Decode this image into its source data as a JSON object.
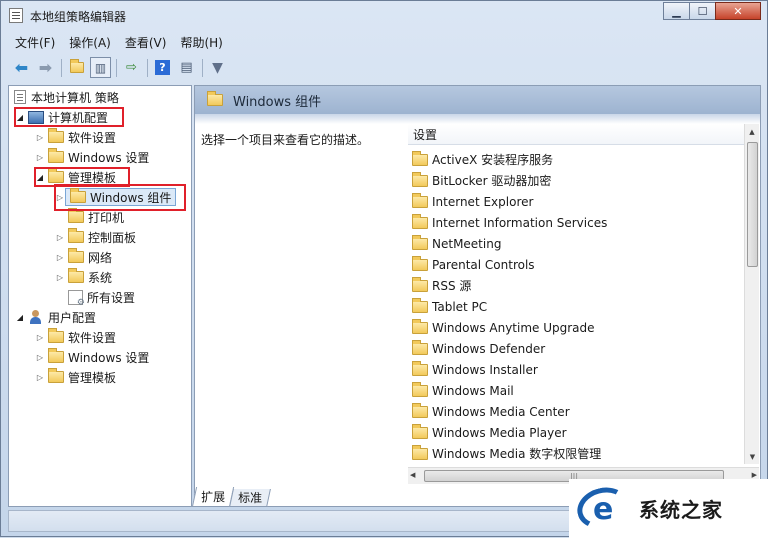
{
  "window": {
    "title": "本地组策略编辑器",
    "controls": {
      "minimize": "▁",
      "maximize": "☐",
      "close": "✕"
    }
  },
  "menu": [
    "文件(F)",
    "操作(A)",
    "查看(V)",
    "帮助(H)"
  ],
  "toolbar": {
    "buttons": [
      "back-icon",
      "forward-icon",
      "up-folder-icon",
      "show-hide-tree-icon",
      "export-list-icon",
      "help-icon",
      "properties-icon",
      "filter-icon"
    ]
  },
  "tree": {
    "root": "本地计算机 策略",
    "computer_config": "计算机配置",
    "cc_software": "软件设置",
    "cc_windows": "Windows 设置",
    "cc_admin": "管理模板",
    "cc_admin_windows": "Windows 组件",
    "cc_admin_printer": "打印机",
    "cc_admin_control": "控制面板",
    "cc_admin_network": "网络",
    "cc_admin_system": "系统",
    "cc_admin_all": "所有设置",
    "user_config": "用户配置",
    "uc_software": "软件设置",
    "uc_windows": "Windows 设置",
    "uc_admin": "管理模板"
  },
  "right_pane": {
    "header": "Windows 组件",
    "description": "选择一个项目来查看它的描述。",
    "column_header": "设置",
    "items": [
      "ActiveX 安装程序服务",
      "BitLocker 驱动器加密",
      "Internet Explorer",
      "Internet Information Services",
      "NetMeeting",
      "Parental Controls",
      "RSS 源",
      "Tablet PC",
      "Windows Anytime Upgrade",
      "Windows Defender",
      "Windows Installer",
      "Windows Mail",
      "Windows Media Center",
      "Windows Media Player",
      "Windows Media 数字权限管理"
    ]
  },
  "tabs": [
    "扩展",
    "标准"
  ],
  "watermark": {
    "text": "系统之家"
  }
}
